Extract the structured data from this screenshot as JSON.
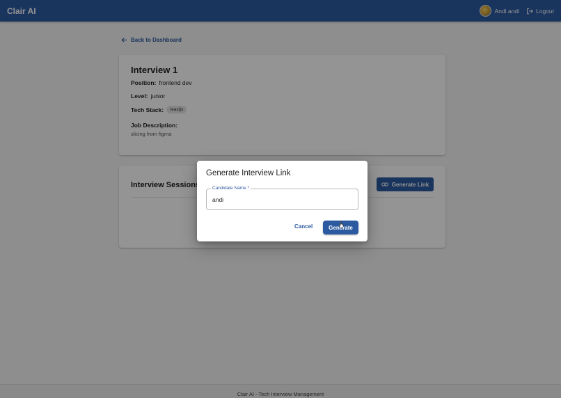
{
  "app": {
    "title": "Clair AI"
  },
  "user": {
    "name": "Andi andi",
    "logout_label": "Logout"
  },
  "nav": {
    "back_label": "Back to Dashboard"
  },
  "interview": {
    "title": "Interview 1",
    "position_label": "Position:",
    "position": "frontend dev",
    "level_label": "Level:",
    "level": "junior",
    "tech_stack_label": "Tech Stack:",
    "tech_stack": [
      "reactjs"
    ],
    "job_description_label": "Job Description:",
    "job_description": "slicing from figma"
  },
  "sessions": {
    "title": "Interview Sessions",
    "generate_link_label": "Generate Link"
  },
  "dialog": {
    "title": "Generate Interview Link",
    "field_label": "Candidate Name *",
    "field_value": "andi",
    "cancel_label": "Cancel",
    "generate_label": "Generate"
  },
  "footer": {
    "text": "Clair AI - Tech Interview Management"
  },
  "colors": {
    "primary": "#2c5aa0",
    "backdrop": "rgba(0,0,0,0.42)"
  }
}
